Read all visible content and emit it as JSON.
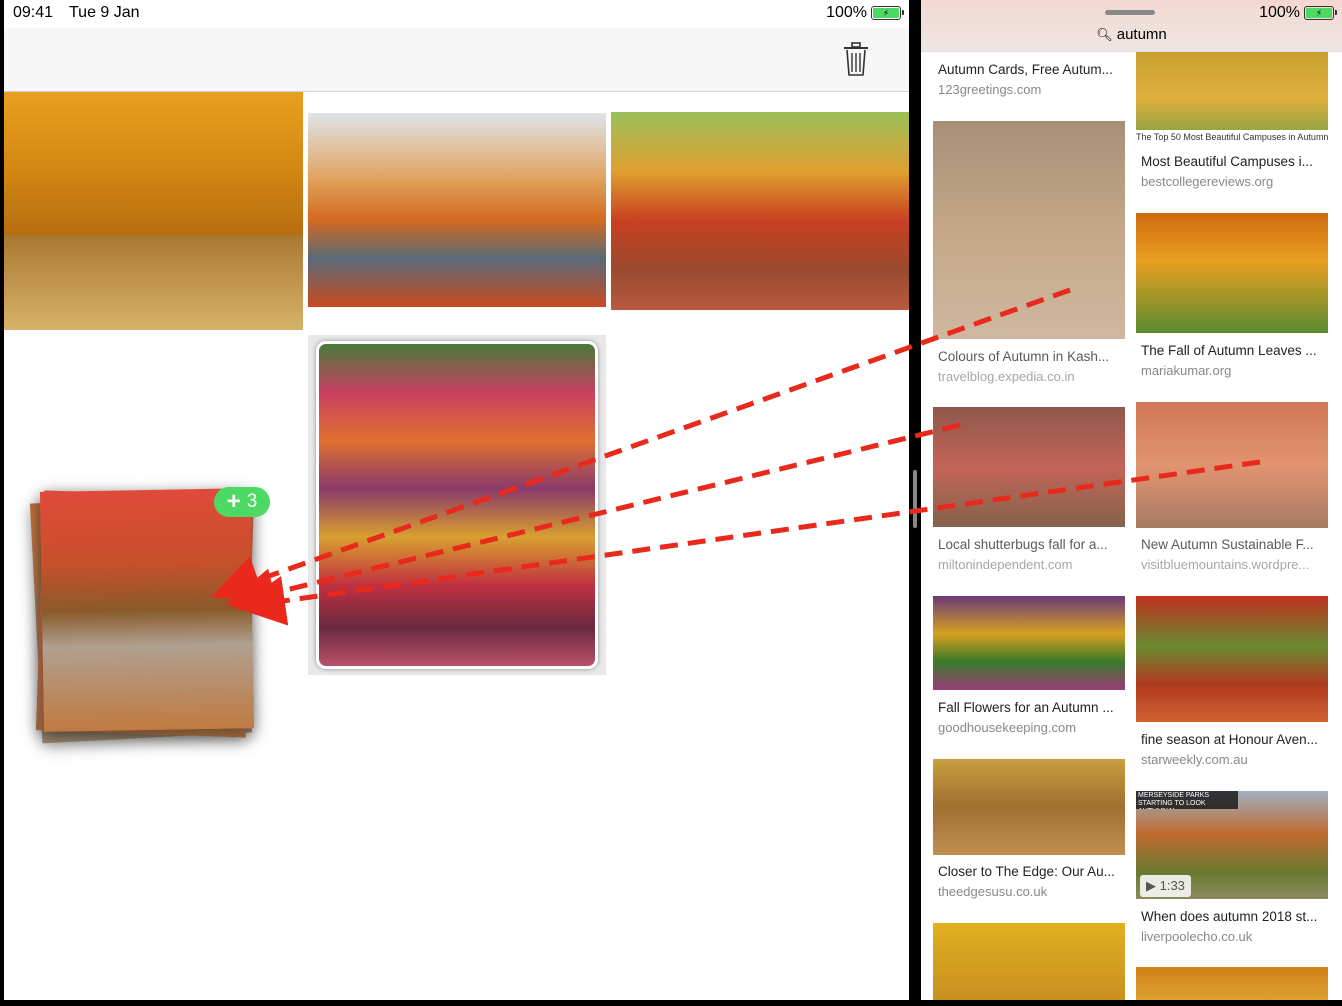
{
  "left_status": {
    "time": "09:41",
    "date": "Tue 9 Jan",
    "battery": "100%"
  },
  "right_status": {
    "battery": "100%"
  },
  "search": {
    "query": "autumn"
  },
  "drag": {
    "count": "3"
  },
  "results": [
    {
      "title": "Autumn Cards, Free Autum...",
      "source": "123greetings.com"
    },
    {
      "title": "Most Beautiful Campuses i...",
      "source": "bestcollegereviews.org",
      "overlay_text": "The Top 50 Most Beautiful Campuses in Autumn"
    },
    {
      "title": "Colours of Autumn in Kash...",
      "source": "travelblog.expedia.co.in"
    },
    {
      "title": "The Fall of Autumn Leaves ...",
      "source": "mariakumar.org"
    },
    {
      "title": "Local shutterbugs fall for a...",
      "source": "miltonindependent.com"
    },
    {
      "title": "New Autumn Sustainable F...",
      "source": "visitbluemountains.wordpre..."
    },
    {
      "title": "Fall Flowers for an Autumn ...",
      "source": "goodhousekeeping.com"
    },
    {
      "title": "fine season at Honour Aven...",
      "source": "starweekly.com.au"
    },
    {
      "title": "Closer to The Edge: Our Au...",
      "source": "theedgesusu.co.uk"
    },
    {
      "title": "When does autumn 2018 st...",
      "source": "liverpoolecho.co.uk",
      "overlay_text": "MERSEYSIDE PARKS STARTING TO LOOK AUTUMNAL",
      "duration": "1:33"
    }
  ],
  "colors": {
    "accent_green": "#4cd964",
    "arrow_red": "#e8291c"
  }
}
